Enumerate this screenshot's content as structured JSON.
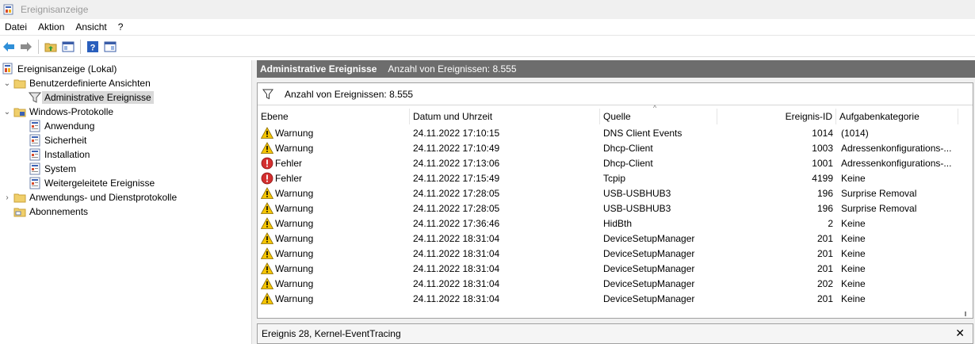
{
  "window": {
    "title": "Ereignisanzeige",
    "icon": "event-viewer-icon"
  },
  "menu": [
    "Datei",
    "Aktion",
    "Ansicht",
    "?"
  ],
  "toolbar": {
    "buttons": [
      "back-arrow-icon",
      "forward-arrow-icon",
      "folder-up-icon",
      "show-hide-console-tree-icon",
      "help-icon",
      "show-hide-action-pane-icon"
    ]
  },
  "tree": {
    "root": "Ereignisanzeige (Lokal)",
    "custom_views": "Benutzerdefinierte Ansichten",
    "admin_events": "Administrative Ereignisse",
    "windows_logs": "Windows-Protokolle",
    "application": "Anwendung",
    "security": "Sicherheit",
    "setup": "Installation",
    "system": "System",
    "forwarded": "Weitergeleitete Ereignisse",
    "apps_services": "Anwendungs- und Dienstprotokolle",
    "subscriptions": "Abonnements"
  },
  "pane": {
    "title": "Administrative Ereignisse",
    "count": "Anzahl von Ereignissen: 8.555",
    "filter_text": "Anzahl von Ereignissen: 8.555"
  },
  "columns": {
    "level": "Ebene",
    "date": "Datum und Uhrzeit",
    "source": "Quelle",
    "id": "Ereignis-ID",
    "category": "Aufgabenkategorie"
  },
  "events": [
    {
      "level": "Warnung",
      "type": "warning",
      "date": "24.11.2022 17:10:15",
      "source": "DNS Client Events",
      "id": "1014",
      "category": "(1014)"
    },
    {
      "level": "Warnung",
      "type": "warning",
      "date": "24.11.2022 17:10:49",
      "source": "Dhcp-Client",
      "id": "1003",
      "category": "Adressenkonfigurations-..."
    },
    {
      "level": "Fehler",
      "type": "error",
      "date": "24.11.2022 17:13:06",
      "source": "Dhcp-Client",
      "id": "1001",
      "category": "Adressenkonfigurations-..."
    },
    {
      "level": "Fehler",
      "type": "error",
      "date": "24.11.2022 17:15:49",
      "source": "Tcpip",
      "id": "4199",
      "category": "Keine"
    },
    {
      "level": "Warnung",
      "type": "warning",
      "date": "24.11.2022 17:28:05",
      "source": "USB-USBHUB3",
      "id": "196",
      "category": "Surprise Removal"
    },
    {
      "level": "Warnung",
      "type": "warning",
      "date": "24.11.2022 17:28:05",
      "source": "USB-USBHUB3",
      "id": "196",
      "category": "Surprise Removal"
    },
    {
      "level": "Warnung",
      "type": "warning",
      "date": "24.11.2022 17:36:46",
      "source": "HidBth",
      "id": "2",
      "category": "Keine"
    },
    {
      "level": "Warnung",
      "type": "warning",
      "date": "24.11.2022 18:31:04",
      "source": "DeviceSetupManager",
      "id": "201",
      "category": "Keine"
    },
    {
      "level": "Warnung",
      "type": "warning",
      "date": "24.11.2022 18:31:04",
      "source": "DeviceSetupManager",
      "id": "201",
      "category": "Keine"
    },
    {
      "level": "Warnung",
      "type": "warning",
      "date": "24.11.2022 18:31:04",
      "source": "DeviceSetupManager",
      "id": "201",
      "category": "Keine"
    },
    {
      "level": "Warnung",
      "type": "warning",
      "date": "24.11.2022 18:31:04",
      "source": "DeviceSetupManager",
      "id": "202",
      "category": "Keine"
    },
    {
      "level": "Warnung",
      "type": "warning",
      "date": "24.11.2022 18:31:04",
      "source": "DeviceSetupManager",
      "id": "201",
      "category": "Keine"
    }
  ],
  "detail": {
    "title": "Ereignis 28, Kernel-EventTracing",
    "close": "✕"
  },
  "colors": {
    "header_bg": "#6d6d6d",
    "warning": "#f5c400",
    "error": "#d32f2f",
    "selection": "#d9d9d9"
  }
}
